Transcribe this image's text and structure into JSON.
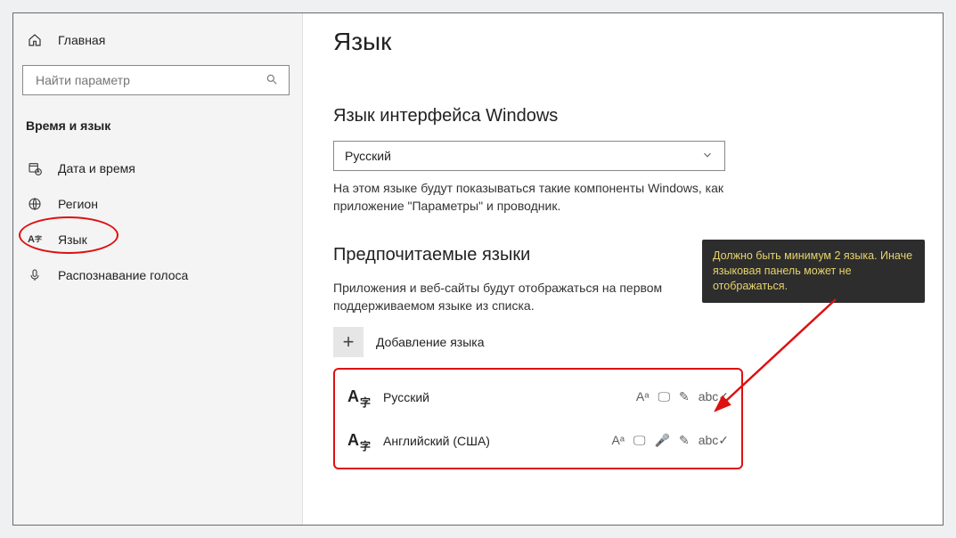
{
  "sidebar": {
    "home": "Главная",
    "search_placeholder": "Найти параметр",
    "section": "Время и язык",
    "items": [
      {
        "label": "Дата и время"
      },
      {
        "label": "Регион"
      },
      {
        "label": "Язык"
      },
      {
        "label": "Распознавание голоса"
      }
    ]
  },
  "page": {
    "title": "Язык",
    "display_lang_title": "Язык интерфейса Windows",
    "display_lang_value": "Русский",
    "display_lang_hint": "На этом языке будут показываться такие компоненты Windows, как приложение \"Параметры\" и проводник.",
    "pref_title": "Предпочитаемые языки",
    "pref_hint": "Приложения и веб-сайты будут отображаться на первом поддерживаемом языке из списка.",
    "add_label": "Добавление языка"
  },
  "languages": [
    {
      "name": "Русский"
    },
    {
      "name": "Английский (США)"
    }
  ],
  "tooltip": "Должно быть минимум 2 языка. Иначе языковая панель может не отображаться."
}
